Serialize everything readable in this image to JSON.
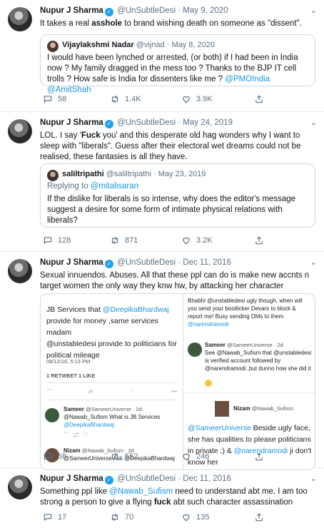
{
  "tweets": [
    {
      "name": "Nupur J Sharma",
      "handle": "@UnSubtleDesi",
      "date": "May 9, 2020",
      "text_pre": "It takes a real ",
      "text_bold": "asshole",
      "text_post": " to brand wishing death on someone as \"dissent\".",
      "quote": {
        "name": "Vijaylakshmi Nadar",
        "handle": "@vijnad",
        "date": "May 8, 2020",
        "text_a": "I would have been lynched or arrested, (or both) if I had been in India now ? My family dragged in the mess too ?  Thanks to the BJP IT cell trolls ? How safe is India for dissenters like me ?  ",
        "mention1": "@PMOIndia",
        "mention2": "@AmitShah"
      },
      "replies": "58",
      "retweets": "1.4K",
      "likes": "3.9K"
    },
    {
      "name": "Nupur J Sharma",
      "handle": "@UnSubtleDesi",
      "date": "May 24, 2019",
      "text_a": "LOL. I say '",
      "text_bold": "Fuck",
      "text_b": " you' and this desperate old hag wonders why I want to sleep with \"liberals\". Guess after their electoral wet dreams could not be realised, these fantasies is all they have.",
      "quote": {
        "name": "saliltripathi",
        "handle": "@saliltripathi",
        "date": "May 23, 2019",
        "reply_label": "Replying to ",
        "reply_to": "@mitalisaran",
        "text": "If the dislike for liberals is so intense, why does the editor's message suggest a desire for some form of intimate physical relations with liberals?"
      },
      "replies": "128",
      "retweets": "871",
      "likes": "3.2K"
    },
    {
      "name": "Nupur J Sharma",
      "handle": "@UnSubtleDesi",
      "date": "Dec 11, 2016",
      "text": "Sexual innuendos. Abuses. All that these ppl can do is make new accnts n target women the only way they knw hw, by attacking her character",
      "media": {
        "left": {
          "line1_pre": "JB Services that ",
          "line1_mention": "@DeepikaBhardwaj",
          "line2": "provide for money ,same services madam",
          "line3": "@unstabledesi provide to politicians for",
          "line4": "political mileage",
          "timestamp": "08/12/16, 5:13 PM",
          "stats": "1 RETWEET  1 LIKE",
          "reply1_name": "Sameer",
          "reply1_handle": "@SameerUniverse · 2d",
          "reply1_text": "@Nawab_Sufism What is JB Services",
          "reply1_mention": "@DeepikaBhardwaj",
          "reply2_name": "Nizam",
          "reply2_handle": "@Nawab_Sufism · 2d",
          "reply2_text": "@SameerUniverse Ask @DeepikaBhardwaj"
        },
        "right": {
          "block1": "Bhabhi @unstabledesi ugly though, when will you send your bootlicker Devars to block & report me! Busy sending DMs to them",
          "block1_mention": "@narendramodi",
          "sameer_name": "Sameer",
          "sameer_handle": "@SameerUniverse · 2d",
          "sameer_text": "See @Nawab_Sufism that @unstabledesi is verified account followed by @narendramodi ,but dunno how she did it",
          "nizam_name": "Nizam",
          "nizam_handle": "@Nawab_Sufism",
          "big_mention": "@SameerUniverse",
          "big_text1": " Beside ugly face, she has qualities to please politicians in private ;) & ",
          "big_mention2": "@narendramodi",
          "big_text2": " ji don't know her"
        }
      },
      "replies": "58",
      "retweets": "552",
      "likes": "246"
    },
    {
      "name": "Nupur J Sharma",
      "handle": "@UnSubtleDesi",
      "date": "Dec 11, 2016",
      "text_a": "Something ppl like ",
      "mention": "@Nawab_Sufism",
      "text_b": " need to understand abt me. I am too strong a person to give a flying ",
      "text_bold": "fuck",
      "text_c": " abt such character assassination",
      "replies": "17",
      "retweets": "70",
      "likes": "135"
    }
  ],
  "icons": {
    "reply": "reply-icon",
    "retweet": "retweet-icon",
    "like": "heart-icon",
    "share": "share-icon",
    "verified": "verified-badge-icon",
    "more": "chevron-down-icon"
  },
  "colors": {
    "link": "#1b95e0",
    "verified": "#1da1f2",
    "muted": "#5b7083"
  }
}
